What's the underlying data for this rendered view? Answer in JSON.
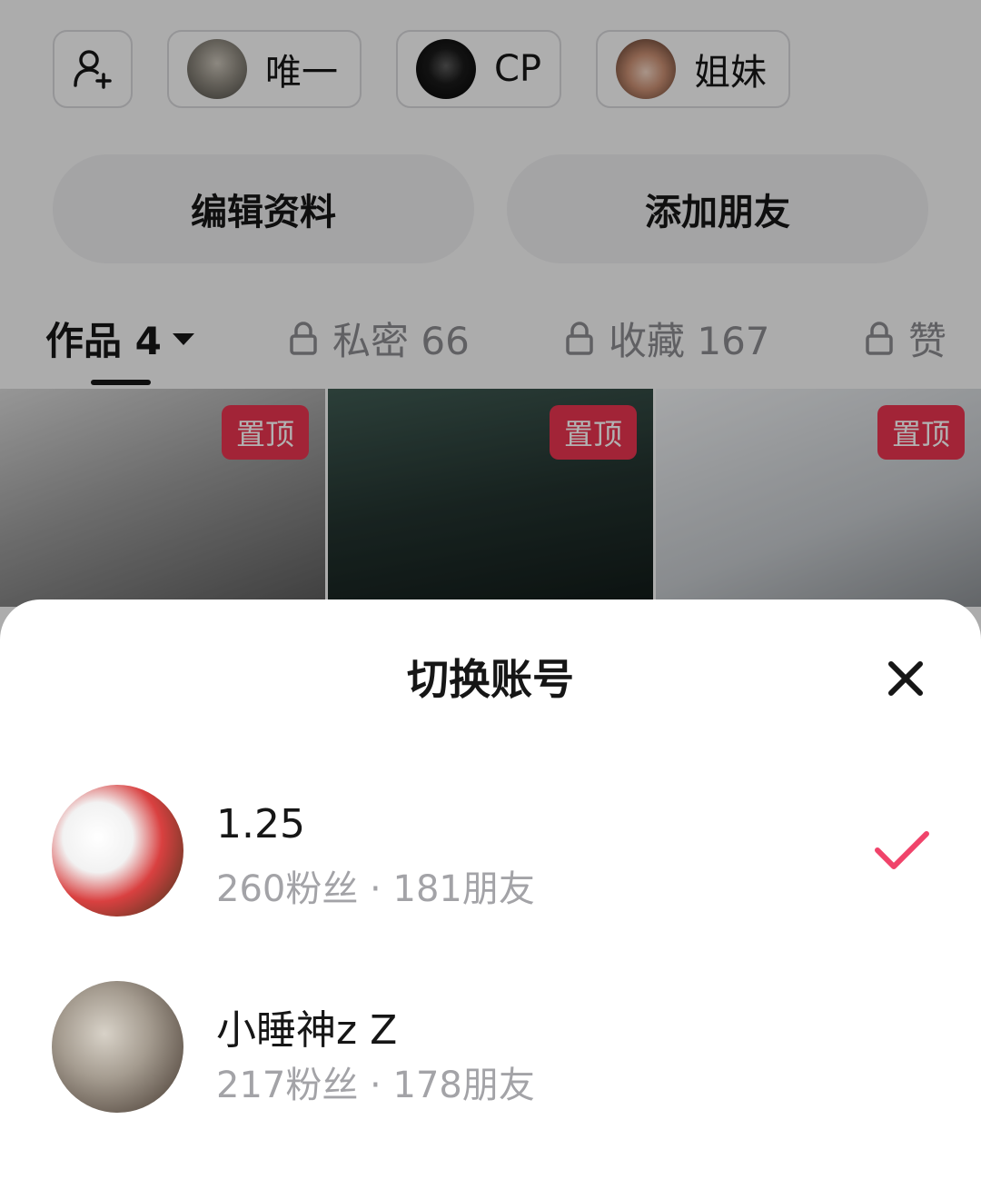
{
  "friend_chips": [
    {
      "label": "唯一"
    },
    {
      "label": "CP"
    },
    {
      "label": "姐妹"
    }
  ],
  "buttons": {
    "edit_profile": "编辑资料",
    "add_friend": "添加朋友"
  },
  "tabs": [
    {
      "label": "作品 4",
      "locked": false,
      "active": true
    },
    {
      "label": "私密 66",
      "locked": true,
      "active": false
    },
    {
      "label": "收藏 167",
      "locked": true,
      "active": false
    },
    {
      "label": "赞",
      "locked": true,
      "active": false
    }
  ],
  "thumbnails": [
    {
      "pin_label": "置顶"
    },
    {
      "pin_label": "置顶"
    },
    {
      "pin_label": "置顶"
    }
  ],
  "sheet": {
    "title": "切换账号",
    "accounts": [
      {
        "name": "1.25",
        "stats": "260粉丝 · 181朋友",
        "selected": true
      },
      {
        "name": "小睡神z Z",
        "stats": "217粉丝 · 178朋友",
        "selected": false
      }
    ]
  },
  "colors": {
    "accent": "#e8344f",
    "check": "#f0436a",
    "text": "#161616",
    "muted": "#a3a3a7"
  }
}
